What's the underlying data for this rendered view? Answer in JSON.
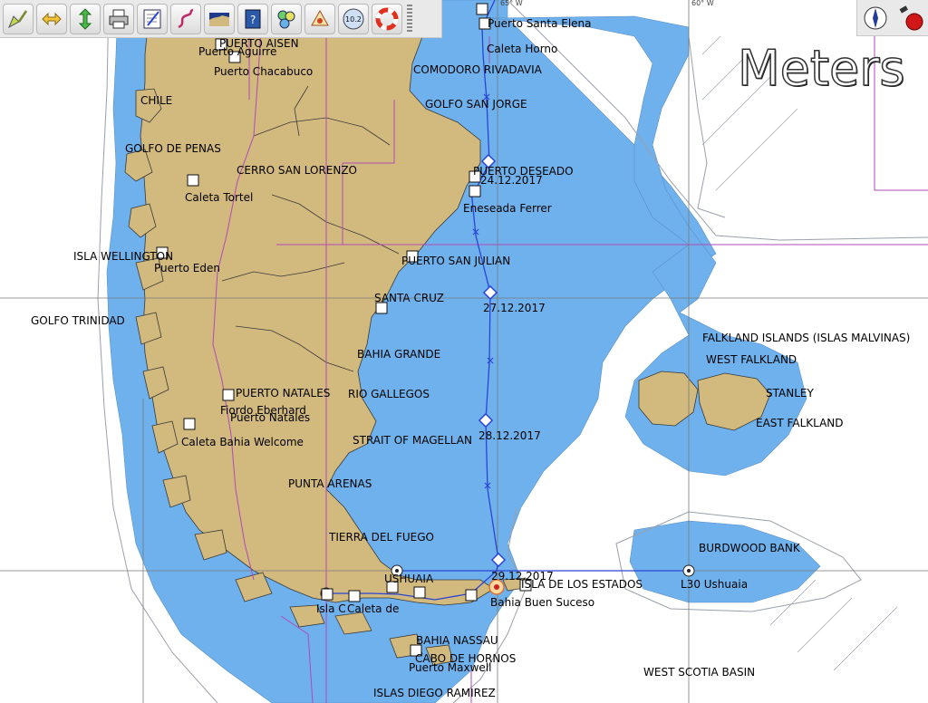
{
  "units_label": "Meters",
  "toolbar": [
    {
      "name": "route-tool-button",
      "icon": "pencil-route-icon"
    },
    {
      "name": "zoom-in-button",
      "icon": "horizontal-arrows-icon"
    },
    {
      "name": "zoom-out-button",
      "icon": "vertical-arrows-icon"
    },
    {
      "name": "print-button",
      "icon": "printer-icon"
    },
    {
      "name": "route-manager-button",
      "icon": "checklist-icon"
    },
    {
      "name": "track-button",
      "icon": "track-icon"
    },
    {
      "name": "chart-quilt-button",
      "icon": "chart-icon"
    },
    {
      "name": "help-button",
      "icon": "help-book-icon"
    },
    {
      "name": "layers-button",
      "icon": "layers-icon"
    },
    {
      "name": "settings-button",
      "icon": "settings-icon"
    },
    {
      "name": "dashboard-button",
      "icon": "gauge-icon",
      "label": "10.2"
    },
    {
      "name": "mob-button",
      "icon": "lifebuoy-icon"
    }
  ],
  "right_tools": [
    {
      "name": "compass-button",
      "icon": "compass-icon"
    },
    {
      "name": "gps-status-button",
      "icon": "gps-icon"
    }
  ],
  "labels": [
    {
      "id": "puerto-santa-elena",
      "text": "Puerto Santa Elena"
    },
    {
      "id": "caleta-horno",
      "text": "Caleta Horno"
    },
    {
      "id": "comodoro-rivadavia",
      "text": "COMODORO RIVADAVIA"
    },
    {
      "id": "golfo-san-jorge",
      "text": "GOLFO SAN JORGE"
    },
    {
      "id": "puerto-aisen",
      "text": "PUERTO AISEN"
    },
    {
      "id": "puerto-aguirre",
      "text": "Puerto Aguirre"
    },
    {
      "id": "puerto-chacabuco",
      "text": "Puerto Chacabuco"
    },
    {
      "id": "chile",
      "text": "CHILE"
    },
    {
      "id": "golfo-de-penas",
      "text": "GOLFO DE PENAS"
    },
    {
      "id": "cerro-san-lorenzo",
      "text": "CERRO SAN LORENZO"
    },
    {
      "id": "caleta-tortel",
      "text": "Caleta Tortel"
    },
    {
      "id": "puerto-deseado",
      "text": "PUERTO DESEADO"
    },
    {
      "id": "date-24",
      "text": "24.12.2017"
    },
    {
      "id": "eneseada-ferrer",
      "text": "Eneseada Ferrer"
    },
    {
      "id": "isla-wellington",
      "text": "ISLA WELLINGTON"
    },
    {
      "id": "puerto-eden",
      "text": "Puerto Eden"
    },
    {
      "id": "puerto-san-julian",
      "text": "PUERTO SAN JULIAN"
    },
    {
      "id": "santa-cruz",
      "text": "SANTA CRUZ"
    },
    {
      "id": "date-27",
      "text": "27.12.2017"
    },
    {
      "id": "golfo-trinidad",
      "text": "GOLFO TRINIDAD"
    },
    {
      "id": "falkland-islands",
      "text": "FALKLAND ISLANDS (ISLAS MALVINAS)"
    },
    {
      "id": "west-falkland",
      "text": "WEST FALKLAND"
    },
    {
      "id": "bahia-grande",
      "text": "BAHIA GRANDE"
    },
    {
      "id": "stanley",
      "text": "STANLEY"
    },
    {
      "id": "puerto-natales-caps",
      "text": "PUERTO NATALES"
    },
    {
      "id": "rio-gallegos",
      "text": "RIO GALLEGOS"
    },
    {
      "id": "fiordo-eberhard",
      "text": "Fiordo Eberhard"
    },
    {
      "id": "puerto-natales",
      "text": "Puerto Natales"
    },
    {
      "id": "east-falkland",
      "text": "EAST FALKLAND"
    },
    {
      "id": "date-28",
      "text": "28.12.2017"
    },
    {
      "id": "caleta-bahia-welcome",
      "text": "Caleta Bahia Welcome"
    },
    {
      "id": "strait-of-magellan",
      "text": "STRAIT OF MAGELLAN"
    },
    {
      "id": "punta-arenas",
      "text": "PUNTA ARENAS"
    },
    {
      "id": "tierra-del-fuego",
      "text": "TIERRA DEL FUEGO"
    },
    {
      "id": "burdwood-bank",
      "text": "BURDWOOD BANK"
    },
    {
      "id": "ushuaia",
      "text": "USHUAIA"
    },
    {
      "id": "date-29",
      "text": "29.12.2017"
    },
    {
      "id": "isla-de-los-estados",
      "text": "ISLA DE LOS ESTADOS"
    },
    {
      "id": "l30-ushuaia",
      "text": "L30 Ushuaia"
    },
    {
      "id": "bahia-buen-suceso",
      "text": "Bahia Buen Suceso"
    },
    {
      "id": "isla-c",
      "text": "Isla C"
    },
    {
      "id": "caleta-de",
      "text": "Caleta de"
    },
    {
      "id": "bahia-nassau",
      "text": "BAHIA NASSAU"
    },
    {
      "id": "cabo-de-hornos",
      "text": "CABO DE HORNOS"
    },
    {
      "id": "puerto-maxwell",
      "text": "Puerto Maxwell"
    },
    {
      "id": "west-scotia-basin",
      "text": "WEST SCOTIA BASIN"
    },
    {
      "id": "islas-diego-ramirez",
      "text": "ISLAS DIEGO RAMIREZ"
    },
    {
      "id": "lon-65w",
      "text": "65° W"
    },
    {
      "id": "lon-60w",
      "text": "60° W"
    }
  ],
  "colors": {
    "land": "#d2b97d",
    "shallow": "#6eb1ec",
    "deep": "#ffffff",
    "shelf_line": "#9aa0aa",
    "route": "#2a44d6",
    "boundary": "#b04ab8",
    "gridline": "#7a7a7a"
  }
}
